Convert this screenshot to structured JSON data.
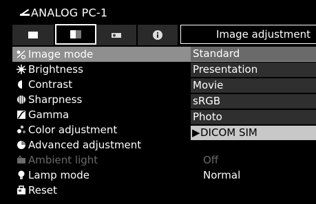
{
  "title": "ANALOG PC-1",
  "header_value": "Image adjustment",
  "tabs": [
    {
      "icon": "display-icon"
    },
    {
      "icon": "image-settings-icon"
    },
    {
      "icon": "install-icon"
    },
    {
      "icon": "info-icon"
    }
  ],
  "menu": [
    {
      "label": "Image mode",
      "icon": "image-mode-icon",
      "value": ""
    },
    {
      "label": "Brightness",
      "icon": "brightness-icon",
      "value": ""
    },
    {
      "label": "Contrast",
      "icon": "contrast-icon",
      "value": ""
    },
    {
      "label": "Sharpness",
      "icon": "sharpness-icon",
      "value": ""
    },
    {
      "label": "Gamma",
      "icon": "gamma-icon",
      "value": ""
    },
    {
      "label": "Color adjustment",
      "icon": "color-adjustment-icon",
      "value": ""
    },
    {
      "label": "Advanced adjustment",
      "icon": "advanced-adjustment-icon",
      "value": ""
    },
    {
      "label": "Ambient light",
      "icon": "ambient-light-icon",
      "value": "Off"
    },
    {
      "label": "Lamp mode",
      "icon": "lamp-icon",
      "value": "Normal"
    },
    {
      "label": "Reset",
      "icon": "reset-icon",
      "value": ""
    }
  ],
  "image_mode_options": [
    "Standard",
    "Presentation",
    "Movie",
    "sRGB",
    "Photo",
    "DICOM SIM"
  ],
  "selected_marker": "▶",
  "colors": {
    "highlight": "#8f8f8f",
    "selected_option": "#c8c8c8",
    "option_bg": "#2f2f2f"
  }
}
